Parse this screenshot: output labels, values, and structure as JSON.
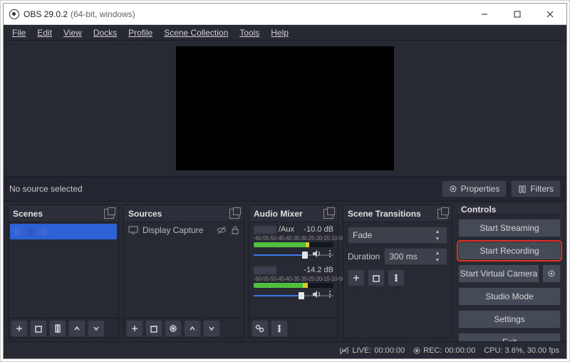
{
  "window": {
    "title": "OBS 29.0.2",
    "title_suffix": "(64-bit, windows)"
  },
  "menubar": [
    "File",
    "Edit",
    "View",
    "Docks",
    "Profile",
    "Scene Collection",
    "Tools",
    "Help"
  ],
  "sourcebar": {
    "selection_text": "No source selected",
    "properties_label": "Properties",
    "filters_label": "Filters"
  },
  "panels": {
    "scenes": {
      "title": "Scenes"
    },
    "sources": {
      "title": "Sources",
      "items": [
        {
          "label": "Display Capture"
        }
      ]
    },
    "mixer": {
      "title": "Audio Mixer",
      "scale": [
        "-60",
        "-55",
        "-50",
        "-45",
        "-40",
        "-35",
        "-30",
        "-25",
        "-20",
        "-15",
        "-10",
        "-5",
        "0"
      ],
      "tracks": [
        {
          "name_suffix": "/Aux",
          "db": "-10.0 dB",
          "green": 65,
          "yellow": 5,
          "fill": 64
        },
        {
          "name_suffix": "",
          "db": "-14.2 dB",
          "green": 62,
          "yellow": 6,
          "fill": 60
        }
      ]
    },
    "transitions": {
      "title": "Scene Transitions",
      "transition": "Fade",
      "duration_label": "Duration",
      "duration_value": "300 ms"
    },
    "controls": {
      "title": "Controls",
      "buttons": {
        "start_streaming": "Start Streaming",
        "start_recording": "Start Recording",
        "start_virtual_camera": "Start Virtual Camera",
        "studio_mode": "Studio Mode",
        "settings": "Settings",
        "exit": "Exit"
      }
    }
  },
  "statusbar": {
    "live_label": "LIVE:",
    "live_time": "00:00:00",
    "rec_label": "REC:",
    "rec_time": "00:00:00",
    "cpu": "CPU: 3.6%, 30.00 fps"
  }
}
